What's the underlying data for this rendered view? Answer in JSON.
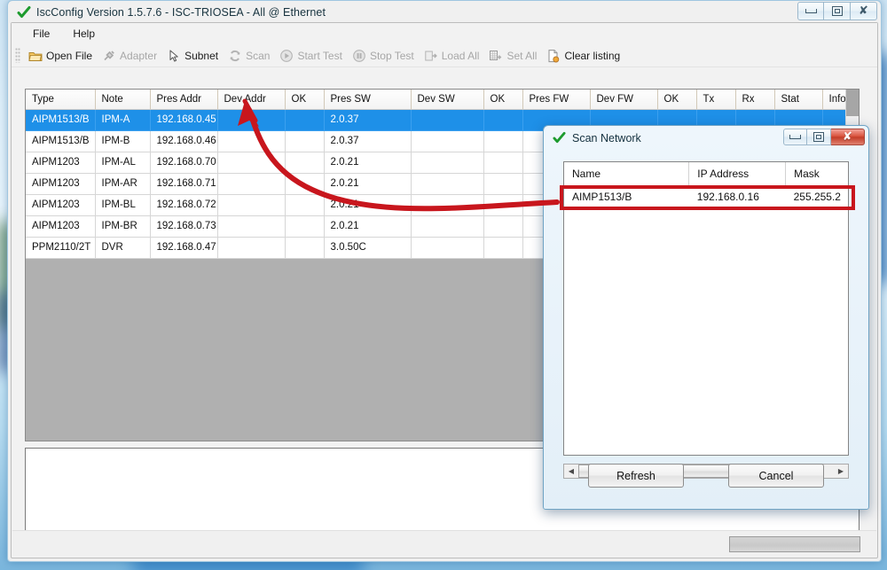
{
  "window": {
    "title": "IscConfig Version 1.5.7.6 - ISC-TRIOSEA - All @ Ethernet",
    "check_icon": "green-check-icon",
    "controls": {
      "minimize": "minimize-icon",
      "maximize": "maximize-icon",
      "close": "close-icon"
    }
  },
  "menubar": {
    "items": [
      {
        "label": "File"
      },
      {
        "label": "Help"
      }
    ]
  },
  "toolbar": {
    "items": [
      {
        "label": "Open File",
        "icon": "folder-icon",
        "enabled": true
      },
      {
        "label": "Adapter",
        "icon": "plug-icon",
        "enabled": false
      },
      {
        "label": "Subnet",
        "icon": "cursor-icon",
        "enabled": true
      },
      {
        "label": "Scan",
        "icon": "refresh-icon",
        "enabled": false
      },
      {
        "label": "Start Test",
        "icon": "play-icon",
        "enabled": false
      },
      {
        "label": "Stop Test",
        "icon": "pause-icon",
        "enabled": false
      },
      {
        "label": "Load All",
        "icon": "download-icon",
        "enabled": false
      },
      {
        "label": "Set All",
        "icon": "upload-grid-icon",
        "enabled": false
      },
      {
        "label": "Clear listing",
        "icon": "clear-page-icon",
        "enabled": true
      }
    ]
  },
  "device_table": {
    "columns": [
      "Type",
      "Note",
      "Pres Addr",
      "Dev Addr",
      "OK",
      "Pres SW",
      "Dev SW",
      "OK",
      "Pres FW",
      "Dev FW",
      "OK",
      "Tx",
      "Rx",
      "Stat",
      "Info"
    ],
    "rows": [
      {
        "selected": true,
        "cells": [
          "AIPM1513/B",
          "IPM-A",
          "192.168.0.45",
          "",
          "",
          "2.0.37",
          "",
          "",
          "",
          "",
          "",
          "",
          "",
          "",
          ""
        ]
      },
      {
        "selected": false,
        "cells": [
          "AIPM1513/B",
          "IPM-B",
          "192.168.0.46",
          "",
          "",
          "2.0.37",
          "",
          "",
          "",
          "",
          "",
          "",
          "",
          "",
          ""
        ]
      },
      {
        "selected": false,
        "cells": [
          "AIPM1203",
          "IPM-AL",
          "192.168.0.70",
          "",
          "",
          "2.0.21",
          "",
          "",
          "",
          "",
          "",
          "",
          "",
          "",
          ""
        ]
      },
      {
        "selected": false,
        "cells": [
          "AIPM1203",
          "IPM-AR",
          "192.168.0.71",
          "",
          "",
          "2.0.21",
          "",
          "",
          "",
          "",
          "",
          "",
          "",
          "",
          ""
        ]
      },
      {
        "selected": false,
        "cells": [
          "AIPM1203",
          "IPM-BL",
          "192.168.0.72",
          "",
          "",
          "2.0.21",
          "",
          "",
          "",
          "",
          "",
          "",
          "",
          "",
          ""
        ]
      },
      {
        "selected": false,
        "cells": [
          "AIPM1203",
          "IPM-BR",
          "192.168.0.73",
          "",
          "",
          "2.0.21",
          "",
          "",
          "",
          "",
          "",
          "",
          "",
          "",
          ""
        ]
      },
      {
        "selected": false,
        "cells": [
          "PPM2110/2T",
          "DVR",
          "192.168.0.47",
          "",
          "",
          "3.0.50C",
          "",
          "",
          "",
          "",
          "",
          "",
          "",
          "",
          ""
        ]
      }
    ]
  },
  "log_pane": {
    "text": ""
  },
  "statusbar": {
    "progress_value": ""
  },
  "dialog": {
    "title": "Scan Network",
    "check_icon": "green-check-icon",
    "controls": {
      "minimize": "minimize-icon",
      "maximize": "maximize-icon",
      "close": "close-icon"
    },
    "list": {
      "columns": [
        "Name",
        "IP Address",
        "Mask"
      ],
      "rows": [
        {
          "name": "AIMP1513/B",
          "ip": "192.168.0.16",
          "mask": "255.255.2"
        }
      ]
    },
    "buttons": {
      "refresh": "Refresh",
      "cancel": "Cancel"
    },
    "hscroll": {
      "left_arrow": "chevron-left-icon",
      "right_arrow": "chevron-right-icon"
    }
  },
  "annotation": {
    "color": "#c8161d",
    "arrow": "curved-arrow-pointing-to-selected-row",
    "highlight": "red-rectangle-around-scan-result-row"
  }
}
